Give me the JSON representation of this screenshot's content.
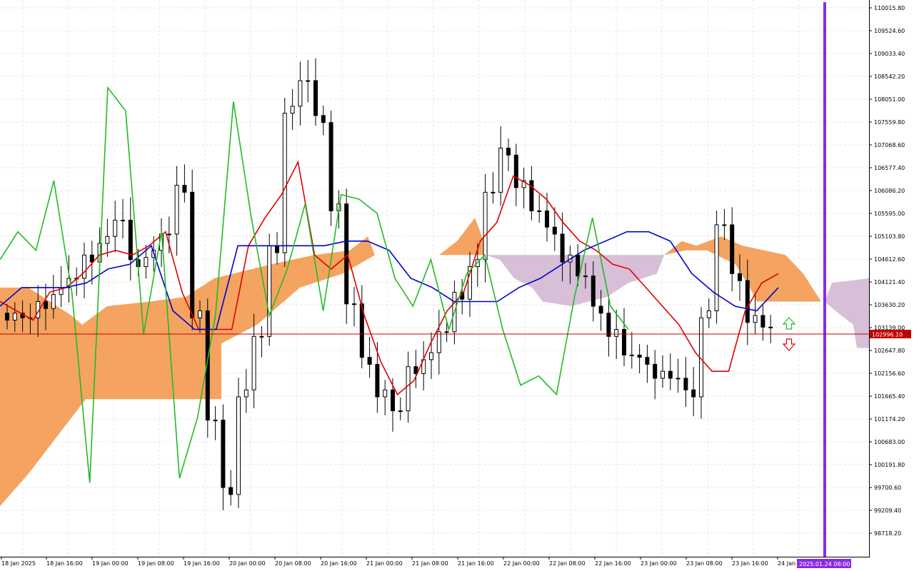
{
  "colors": {
    "background": "#ffffff",
    "grid": "#e6e6e6",
    "axis": "#000000",
    "candle_bull": "#ffffff",
    "candle_bear": "#000000",
    "tenkan": "#e00000",
    "kijun": "#0000cc",
    "chikou": "#22bb22",
    "senkou_bull_fill": "#f4a460",
    "senkou_bear_fill": "#d8bfd8",
    "bid_line": "#c00000",
    "bid_label_bg": "#c00000",
    "vline": "#8a2be2",
    "time_label_bg": "#8a2be2",
    "arrow_up": "#22bb22",
    "arrow_down": "#e00000"
  },
  "chart": {
    "current_price_label": "102996.10",
    "current_time_label": "2025.01.24 08:00",
    "arrow_up_icon": "arrow-up-outline",
    "arrow_down_icon": "arrow-down-outline",
    "price_axis_labels": [
      "110015.80",
      "109524.60",
      "109033.40",
      "108542.20",
      "108051.00",
      "107559.80",
      "107068.60",
      "106577.40",
      "106086.20",
      "105595.00",
      "105103.80",
      "104612.60",
      "104121.40",
      "103630.20",
      "103139.00",
      "102647.80",
      "102156.60",
      "101665.40",
      "101174.20",
      "100683.00",
      "100191.80",
      "99700.60",
      "99209.40",
      "98718.20"
    ],
    "time_axis_labels": [
      "18 Jan 2025",
      "18 Jan 16:00",
      "19 Jan 00:00",
      "19 Jan 08:00",
      "19 Jan 16:00",
      "20 Jan 00:00",
      "20 Jan 08:00",
      "20 Jan 16:00",
      "21 Jan 00:00",
      "21 Jan 08:00",
      "21 Jan 16:00",
      "22 Jan 00:00",
      "22 Jan 08:00",
      "22 Jan 16:00",
      "23 Jan 00:00",
      "23 Jan 08:00",
      "23 Jan 16:00",
      "24 Jan"
    ]
  },
  "chart_data": {
    "type": "candlestick",
    "indicator": "Ichimoku Kinko Hyo",
    "price_range": [
      98400,
      110100
    ],
    "current_price": 102996.1,
    "series": [
      {
        "name": "price",
        "values_close": [
          103450,
          103200,
          103700,
          104000,
          104050,
          104700,
          105100,
          105300,
          104600,
          104800,
          105000,
          106200,
          103500,
          101000,
          99700,
          101800,
          102800,
          104900,
          107900,
          108300,
          107700,
          105800,
          103500,
          102500,
          101800,
          101200,
          102300,
          102600,
          102900,
          103900,
          104600,
          105900,
          107000,
          106300,
          105500,
          105300,
          104700,
          104100,
          103600,
          103100,
          102400,
          102500,
          102200,
          101900,
          101800,
          103500,
          105200,
          104300,
          103400,
          103000
        ]
      },
      {
        "name": "tenkan",
        "values": [
          103700,
          103500,
          103300,
          103900,
          104000,
          104300,
          104700,
          104800,
          104700,
          104900,
          105200,
          103900,
          103100,
          103100,
          103100,
          104900,
          105500,
          106000,
          106700,
          104700,
          104400,
          104700,
          103400,
          102400,
          101700,
          102000,
          102800,
          103500,
          103900,
          105000,
          105400,
          106400,
          106200,
          105900,
          105400,
          105000,
          104800,
          104500,
          104400,
          104000,
          103600,
          103200,
          102600,
          102200,
          102200,
          103500,
          104100,
          104300
        ]
      },
      {
        "name": "kijun",
        "values": [
          103600,
          104000,
          104000,
          104000,
          104100,
          104400,
          104500,
          104900,
          103500,
          103100,
          103100,
          104900,
          104900,
          104900,
          104900,
          104900,
          105000,
          105000,
          104800,
          104200,
          104000,
          103700,
          103700,
          103700,
          104000,
          104200,
          104500,
          104800,
          105000,
          105200,
          105200,
          105000,
          104300,
          103900,
          103600,
          103500,
          104000
        ]
      },
      {
        "name": "chikou",
        "values": [
          104600,
          105200,
          104800,
          106300,
          103900,
          99800,
          108300,
          107800,
          103000,
          105200,
          99900,
          101200,
          103400,
          108000,
          105500,
          103400,
          104400,
          105800,
          103500,
          106000,
          105900,
          105600,
          104200,
          103600,
          104600,
          103100,
          104300,
          104700,
          103100,
          101900,
          102100,
          101700,
          103800,
          105500,
          103600,
          103100
        ]
      }
    ]
  }
}
